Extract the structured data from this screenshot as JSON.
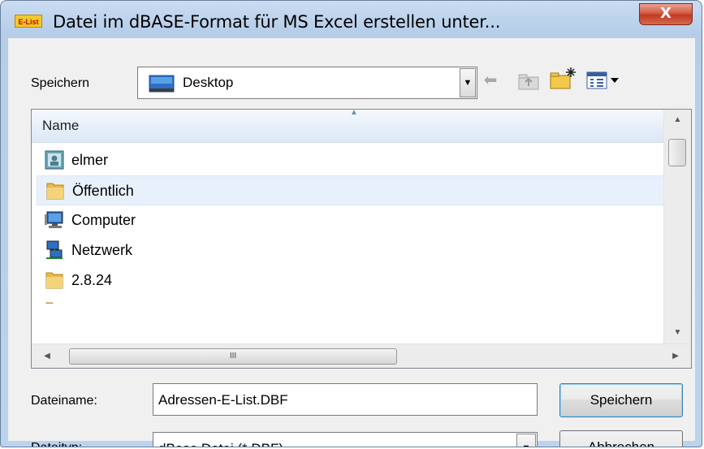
{
  "window": {
    "app_icon_text": "E-List",
    "title": "Datei im dBASE-Format für MS Excel erstellen unter...",
    "close_glyph": "X"
  },
  "save_in": {
    "label": "Speichern",
    "value": "Desktop",
    "icon": "desktop-icon"
  },
  "toolbar": {
    "back_icon": "back-arrow-icon",
    "up_icon": "up-folder-icon",
    "new_folder_icon": "new-folder-icon",
    "view_menu_icon": "view-menu-icon"
  },
  "file_list": {
    "column_header": "Name",
    "items": [
      {
        "name": "elmer",
        "icon": "user-folder-icon",
        "selected": false
      },
      {
        "name": "Öffentlich",
        "icon": "folder-icon",
        "selected": true
      },
      {
        "name": "Computer",
        "icon": "computer-icon",
        "selected": false
      },
      {
        "name": "Netzwerk",
        "icon": "network-icon",
        "selected": false
      },
      {
        "name": "2.8.24",
        "icon": "folder-icon",
        "selected": false
      }
    ],
    "hscroll_grip": "III"
  },
  "filename": {
    "label": "Dateiname:",
    "value": "Adressen-E-List.DBF"
  },
  "filetype": {
    "label": "Dateityp:",
    "value": "dBase Datei (*.DBF)"
  },
  "buttons": {
    "save": "Speichern",
    "cancel": "Abbrechen"
  },
  "colors": {
    "selection": "#e8f1fb",
    "title_bar": "#c9dcf2",
    "close_button": "#c03a22",
    "folder": "#e8b84a"
  }
}
